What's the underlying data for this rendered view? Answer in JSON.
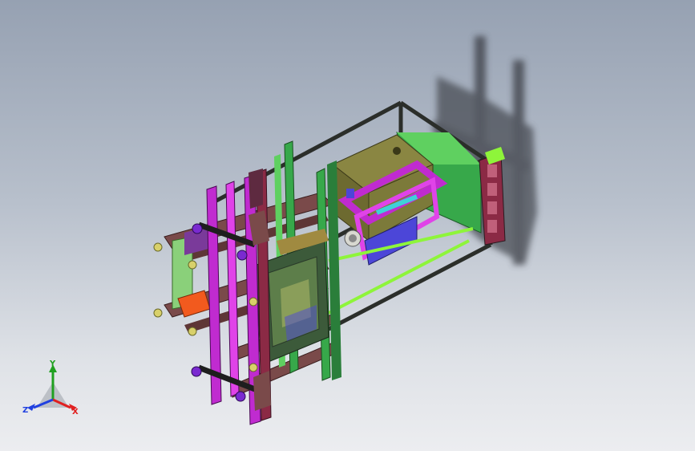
{
  "app": {
    "view_name": "cad-3d-viewport"
  },
  "colors": {
    "background_top": "#96a1b2",
    "background_bottom": "#ecedf0",
    "frame": "#2b2e2a",
    "tie_bar": "#8ef53a",
    "green_part": "#37a84a",
    "purple_part": "#c02bd0",
    "magenta_part": "#e043e8",
    "brown_part": "#7a4a4a",
    "olive_part": "#7c7a3a",
    "blue_part": "#4c46d8",
    "orange_part": "#f25a1e",
    "dark_green_plate": "#3c5a3a",
    "cyan_part": "#3fd0d8",
    "knob": "#d8d06a",
    "shadow": "#3a3e44"
  },
  "triad": {
    "x_label": "X",
    "y_label": "Y",
    "z_label": "Z",
    "x_color": "#e02020",
    "y_color": "#20a020",
    "z_color": "#2040e0"
  }
}
